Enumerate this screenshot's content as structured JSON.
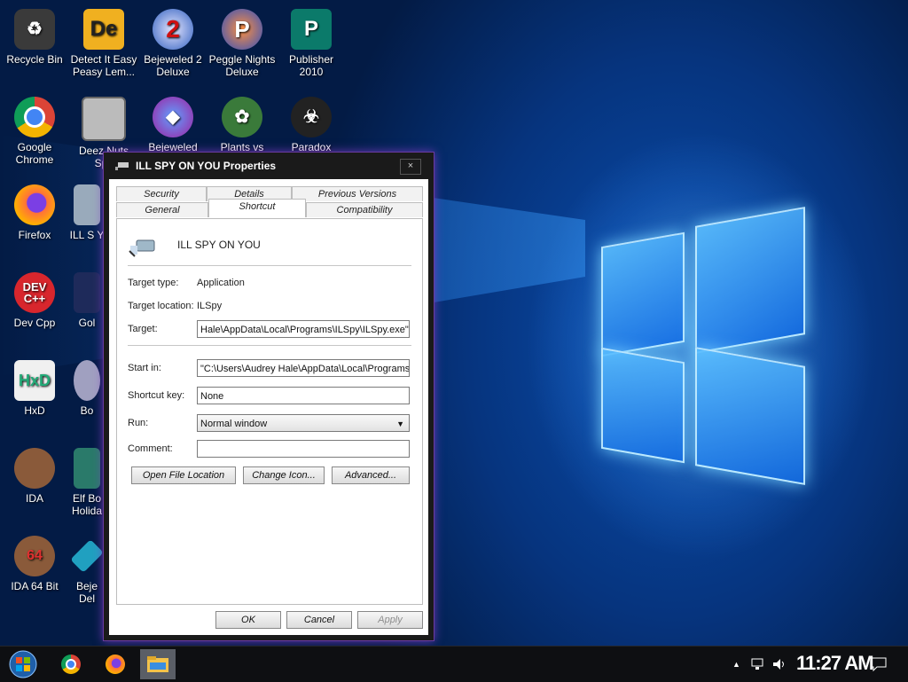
{
  "desktop": {
    "icons": [
      {
        "label": "Recycle Bin"
      },
      {
        "label": "Detect It Easy Peasy Lem..."
      },
      {
        "label": "Bejeweled 2 Deluxe"
      },
      {
        "label": "Peggle Nights Deluxe"
      },
      {
        "label": "Publisher 2010"
      },
      {
        "label": "Google Chrome"
      },
      {
        "label": "Deez Nuts Spy"
      },
      {
        "label": "Bejeweled"
      },
      {
        "label": "Plants vs"
      },
      {
        "label": "Paradox"
      },
      {
        "label": "Firefox"
      },
      {
        "label": "ILL S Y"
      },
      {
        "label": "Dev Cpp"
      },
      {
        "label": "Gol"
      },
      {
        "label": "HxD"
      },
      {
        "label": "Bo"
      },
      {
        "label": "IDA"
      },
      {
        "label": "Elf Bo Holida"
      },
      {
        "label": "IDA 64 Bit"
      },
      {
        "label": "Beje Del"
      }
    ]
  },
  "dialog": {
    "title": "ILL SPY ON YOU Properties",
    "close": "×",
    "tabs_top": [
      "Security",
      "Details",
      "Previous Versions"
    ],
    "tabs_bottom": [
      "General",
      "Shortcut",
      "Compatibility"
    ],
    "shortcut_name": "ILL SPY ON YOU",
    "labels": {
      "target_type": "Target type:",
      "target_location": "Target location:",
      "target": "Target:",
      "start_in": "Start in:",
      "shortcut_key": "Shortcut key:",
      "run": "Run:",
      "comment": "Comment:"
    },
    "values": {
      "target_type": "Application",
      "target_location": "ILSpy",
      "target": "Hale\\AppData\\Local\\Programs\\ILSpy\\ILSpy.exe\"",
      "start_in": "\"C:\\Users\\Audrey Hale\\AppData\\Local\\Programs",
      "shortcut_key": "None",
      "run": "Normal window",
      "comment": ""
    },
    "buttons": {
      "open_file_location": "Open File Location",
      "change_icon": "Change Icon...",
      "advanced": "Advanced...",
      "ok": "OK",
      "cancel": "Cancel",
      "apply": "Apply"
    }
  },
  "taskbar": {
    "clock": "11:27 AM",
    "tray_chevron": "▲"
  }
}
